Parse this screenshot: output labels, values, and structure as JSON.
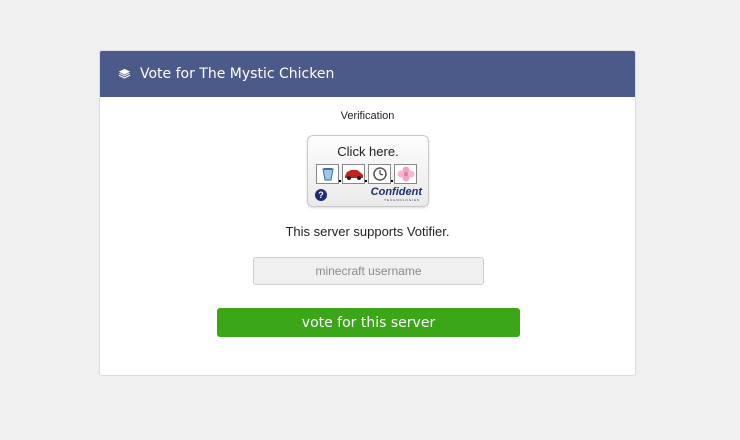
{
  "header": {
    "title": "Vote for The Mystic Chicken",
    "icon": "layers-icon",
    "background": "#4c5a8a"
  },
  "verification": {
    "label": "Verification",
    "captcha": {
      "prompt": "Click here.",
      "images": [
        "cup-icon",
        "car-icon",
        "watch-icon",
        "flower-icon"
      ],
      "help": "?",
      "brand": "Confident",
      "brand_sub": "TECHNOLOGIES"
    }
  },
  "votifier_text": "This server supports Votifier.",
  "username": {
    "value": "",
    "placeholder": "minecraft username"
  },
  "vote_button": {
    "label": "vote for this server",
    "color": "#3aa618"
  }
}
